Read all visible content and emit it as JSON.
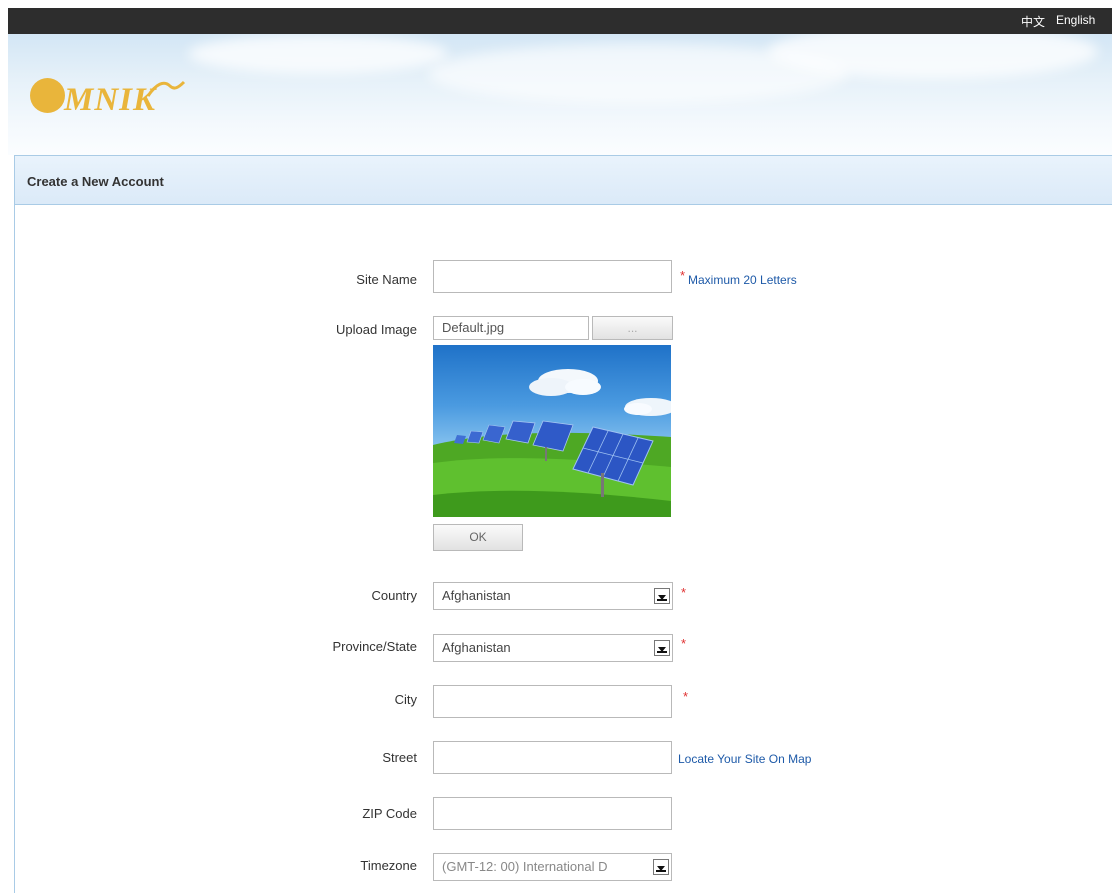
{
  "topbar": {
    "languages": [
      "中文",
      "English"
    ]
  },
  "brand": {
    "logo_text": "MNIK",
    "logo_color": "#e9b53b"
  },
  "panel": {
    "title": "Create a New Account"
  },
  "form": {
    "site_name": {
      "label": "Site Name",
      "value": "",
      "required": "*",
      "hint": "Maximum 20 Letters"
    },
    "upload_image": {
      "label": "Upload Image",
      "filename": "Default.jpg",
      "browse_label": "...",
      "ok_label": "OK"
    },
    "country": {
      "label": "Country",
      "selected": "Afghanistan",
      "required": "*"
    },
    "province": {
      "label": "Province/State",
      "selected": "Afghanistan",
      "required": "*"
    },
    "city": {
      "label": "City",
      "value": "",
      "required": "*"
    },
    "street": {
      "label": "Street",
      "value": "",
      "link": "Locate Your Site On Map"
    },
    "zip": {
      "label": "ZIP Code",
      "value": ""
    },
    "timezone": {
      "label": "Timezone",
      "selected": "(GMT-12: 00) International D"
    }
  },
  "colors": {
    "topbar": "#2d2d2d",
    "required_star": "#e03030",
    "link": "#1e5aa8",
    "header_border": "#a9cbe6"
  }
}
